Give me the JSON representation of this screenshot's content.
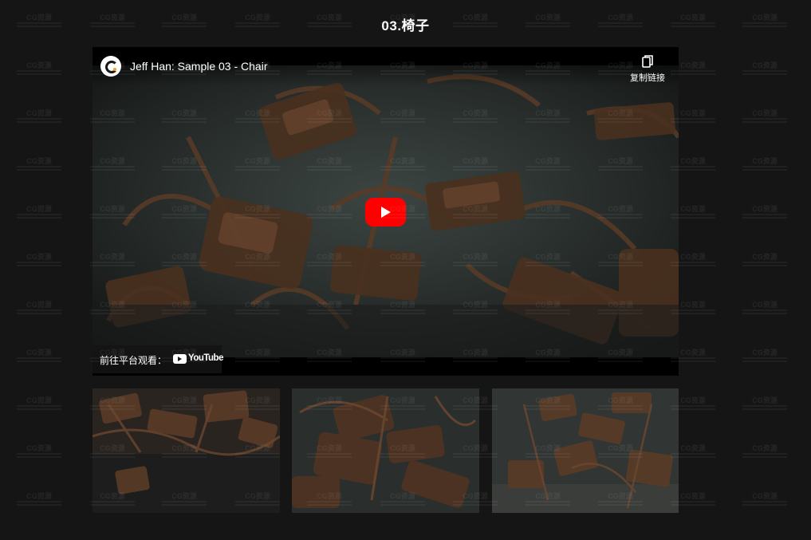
{
  "section": {
    "title": "03.椅子"
  },
  "player": {
    "video_title": "Jeff Han: Sample 03 - Chair",
    "copy_link_label": "复制链接",
    "watch_on_label": "前往平台观看：",
    "platform_name": "YouTube",
    "play_icon": "play-icon",
    "copy_icon": "copy-icon",
    "accent_color": "#ff0000"
  },
  "thumbnails": [
    {
      "name": "thumbnail-1"
    },
    {
      "name": "thumbnail-2"
    },
    {
      "name": "thumbnail-3"
    }
  ],
  "watermark": {
    "logo_text": "CG资源"
  },
  "colors": {
    "background": "#151515",
    "text": "#ffffff",
    "youtube_red": "#ff0000"
  }
}
